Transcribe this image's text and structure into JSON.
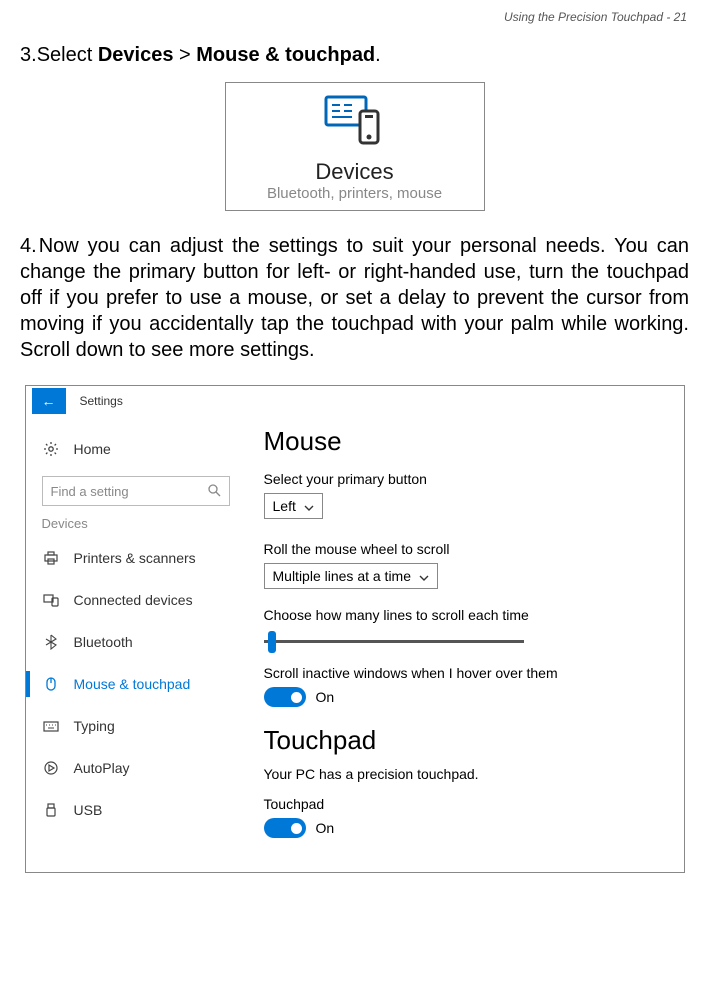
{
  "header": "Using the Precision Touchpad - 21",
  "step3": {
    "num": "3.",
    "pre": "Select ",
    "b1": "Devices",
    "mid": " > ",
    "b2": "Mouse & touchpad",
    "end": "."
  },
  "tile": {
    "title": "Devices",
    "subtitle": "Bluetooth, printers, mouse"
  },
  "step4": {
    "num": "4.",
    "text": "Now you can adjust the settings to suit your personal needs. You can change the primary button for left- or right-handed use, turn the touchpad off if you prefer to use a mouse, or set a delay to prevent the cursor from moving if you accidentally tap the touchpad with your palm while working. Scroll down to see more settings."
  },
  "settings": {
    "titlebar": "Settings",
    "sidebar": {
      "searchPlaceholder": "Find a setting",
      "home": "Home",
      "section": "Devices",
      "items": {
        "printers": "Printers & scanners",
        "connected": "Connected devices",
        "bluetooth": "Bluetooth",
        "mouse": "Mouse & touchpad",
        "typing": "Typing",
        "autoplay": "AutoPlay",
        "usb": "USB"
      }
    },
    "main": {
      "mouseHeading": "Mouse",
      "primaryLabel": "Select your primary button",
      "primaryValue": "Left",
      "scrollLabel": "Roll the mouse wheel to scroll",
      "scrollValue": "Multiple lines at a time",
      "linesLabel": "Choose how many lines to scroll each time",
      "inactiveLabel": "Scroll inactive windows when I hover over them",
      "inactiveToggle": "On",
      "touchpadHeading": "Touchpad",
      "touchpadDesc": "Your PC has a precision touchpad.",
      "touchpadLabel": "Touchpad",
      "touchpadToggle": "On"
    }
  }
}
